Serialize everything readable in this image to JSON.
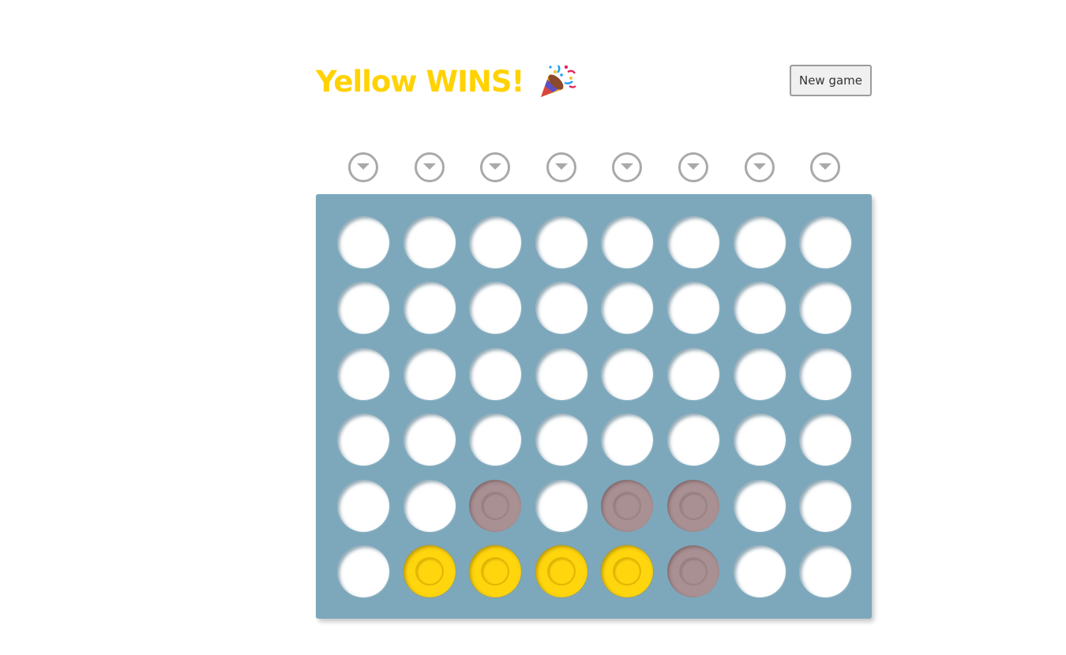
{
  "status": {
    "text": "Yellow WINS!",
    "emoji_icon": "party-popper-icon",
    "color": "#ffd200"
  },
  "new_game_button": {
    "label": "New game"
  },
  "drop_buttons": {
    "count": 8,
    "icon": "chevron-down-icon"
  },
  "board": {
    "columns": 8,
    "rows": 6,
    "background_color": "#7da8bc",
    "player_colors": {
      "yellow": "#ffd60e",
      "red": "#a99093",
      "empty": "#ffffff"
    },
    "cells": [
      [
        "empty",
        "empty",
        "empty",
        "empty",
        "empty",
        "empty",
        "empty",
        "empty"
      ],
      [
        "empty",
        "empty",
        "empty",
        "empty",
        "empty",
        "empty",
        "empty",
        "empty"
      ],
      [
        "empty",
        "empty",
        "empty",
        "empty",
        "empty",
        "empty",
        "empty",
        "empty"
      ],
      [
        "empty",
        "empty",
        "empty",
        "empty",
        "empty",
        "empty",
        "empty",
        "empty"
      ],
      [
        "empty",
        "empty",
        "red",
        "empty",
        "red",
        "red",
        "empty",
        "empty"
      ],
      [
        "empty",
        "yellow",
        "yellow",
        "yellow",
        "yellow",
        "red",
        "empty",
        "empty"
      ]
    ]
  }
}
